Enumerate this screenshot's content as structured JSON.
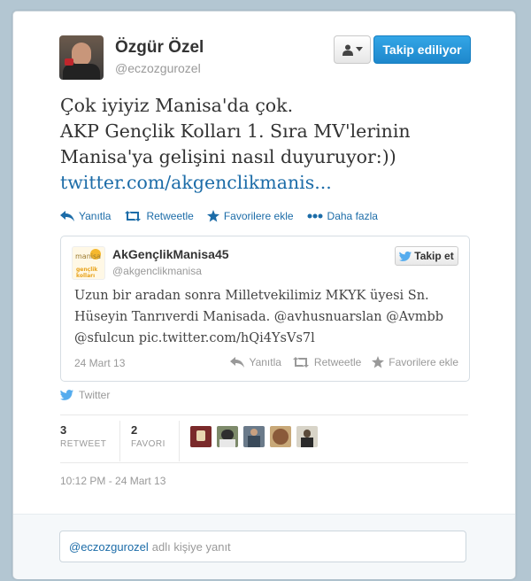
{
  "colors": {
    "link": "#1c6ca8",
    "button_blue": "#1e88cc",
    "twitter_bird": "#55acee",
    "star": "#1c6ca8"
  },
  "author": {
    "name": "Özgür Özel",
    "handle": "@eczozgurozel"
  },
  "header_buttons": {
    "user_menu_icon": "user-dropdown-icon",
    "following_label": "Takip ediliyor"
  },
  "tweet": {
    "lines": [
      "Çok iyiyiz Manisa'da çok.",
      "AKP Gençlik Kolları 1. Sıra MV'lerinin",
      "Manisa'ya gelişini nasıl duyuruyor:))"
    ],
    "link": "twitter.com/akgenclikmanis..."
  },
  "actions": {
    "reply": "Yanıtla",
    "retweet": "Retweetle",
    "favorite": "Favorilere ekle",
    "more": "Daha fazla"
  },
  "quoted": {
    "logo_text_top": "manisa",
    "logo_text_bottom": "gençlik kolları",
    "name": "AkGençlikManisa45",
    "handle": "@akgenclikmanisa",
    "follow_label": "Takip et",
    "lines": [
      "Uzun bir aradan sonra Milletvekilimiz MKYK üyesi Sn.",
      "Hüseyin Tanrıverdi Manisada. @avhusnuarslan @Avmbb",
      "@sfulcun pic.twitter.com/hQi4YsVs7l"
    ],
    "date": "24 Mart 13",
    "actions": {
      "reply": "Yanıtla",
      "retweet": "Retweetle",
      "favorite": "Favorilere ekle"
    }
  },
  "source": "Twitter",
  "stats": {
    "retweets": {
      "count": "3",
      "label": "RETWEET"
    },
    "favorites": {
      "count": "2",
      "label": "FAVORI"
    }
  },
  "favoriters": [
    {
      "name": "favoriter-1",
      "color": "#7a2a2a"
    },
    {
      "name": "favoriter-2",
      "color": "#5a6e4a"
    },
    {
      "name": "favoriter-3",
      "color": "#4a5a6a"
    },
    {
      "name": "favoriter-4",
      "color": "#8a6a4a"
    },
    {
      "name": "favoriter-5",
      "color": "#6a6a5a"
    }
  ],
  "timestamp": "10:12 PM - 24 Mart 13",
  "reply": {
    "handle": "@eczozgurozel",
    "placeholder_suffix": "adlı kişiye yanıt"
  }
}
